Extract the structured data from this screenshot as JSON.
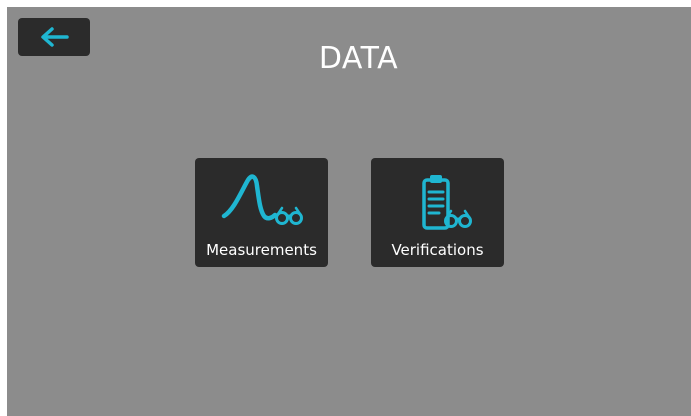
{
  "header": {
    "title": "DATA",
    "back_icon": "back-arrow-icon"
  },
  "menu": {
    "items": [
      {
        "label": "Measurements",
        "icon": "measurement-waveform-icon"
      },
      {
        "label": "Verifications",
        "icon": "verification-clipboard-icon"
      }
    ]
  },
  "colors": {
    "background": "#8c8c8c",
    "button": "#2b2b2b",
    "accent": "#1fb6d1",
    "text": "#ffffff"
  }
}
